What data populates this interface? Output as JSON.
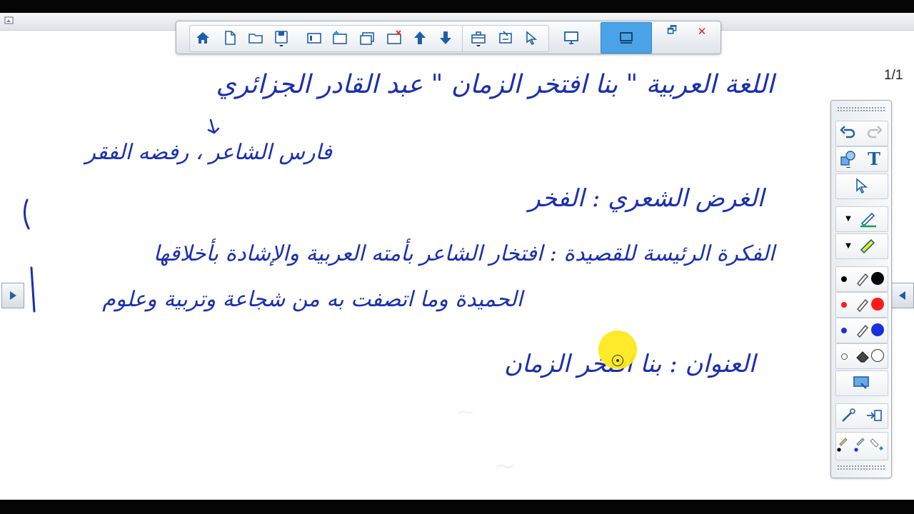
{
  "page": {
    "counter": "1/1"
  },
  "toolbar": {
    "buttons": [
      "home",
      "new-page",
      "open",
      "save",
      "page-sorter",
      "add-page",
      "duplicate-page",
      "delete-page",
      "previous-page",
      "next-page",
      "toolbox",
      "capture",
      "select",
      "desktop-mode",
      "full-screen"
    ],
    "restore_label": "🗗",
    "close_label": "✕",
    "active_color": "#4aa3e6"
  },
  "whiteboard": {
    "lines": [
      {
        "text": "اللغة العربية \" بنا افتخر الزمان \" عبد القادر الجزائري",
        "size": 36
      },
      {
        "text": "فارس الشاعر ، رفضه الفقر",
        "size": 30
      },
      {
        "text": "الغرض الشعري : الفخر",
        "size": 34
      },
      {
        "text": "الفكرة الرئيسة للقصيدة : افتخار الشاعر بأمته العربية والإشادة بأخلاقها",
        "size": 31
      },
      {
        "text": "الحميدة وما اتصفت به من شجاعة وتربية وعلوم",
        "size": 31
      },
      {
        "text": "العنوان : بنا افتخر الزمان",
        "size": 34
      }
    ],
    "ink_color": "#1a2fb0"
  },
  "palette": {
    "colors": {
      "black": "#000000",
      "red": "#ff1a1a",
      "blue": "#1a2fe0",
      "white": "#ffffff",
      "highlighter": "#f5f000",
      "pen_green": "#1aa14a"
    },
    "tools": [
      "undo",
      "redo",
      "shapes",
      "text",
      "select",
      "pen",
      "highlighter",
      "eraser",
      "screen-shade",
      "pointer",
      "insert"
    ]
  }
}
